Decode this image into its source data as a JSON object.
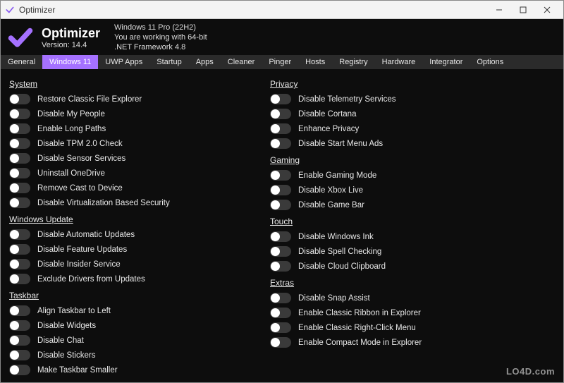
{
  "window": {
    "title": "Optimizer"
  },
  "header": {
    "app_name": "Optimizer",
    "version_label": "Version: 14.4",
    "os_line": "Windows 11 Pro (22H2)",
    "arch_line": "You are working with 64-bit",
    "net_line": ".NET Framework 4.8"
  },
  "tabs": {
    "items": [
      {
        "label": "General"
      },
      {
        "label": "Windows 11",
        "active": true
      },
      {
        "label": "UWP Apps"
      },
      {
        "label": "Startup"
      },
      {
        "label": "Apps"
      },
      {
        "label": "Cleaner"
      },
      {
        "label": "Pinger"
      },
      {
        "label": "Hosts"
      },
      {
        "label": "Registry"
      },
      {
        "label": "Hardware"
      },
      {
        "label": "Integrator"
      },
      {
        "label": "Options"
      }
    ]
  },
  "left": {
    "sections": [
      {
        "title": "System",
        "items": [
          {
            "label": "Restore Classic File Explorer"
          },
          {
            "label": "Disable My People"
          },
          {
            "label": "Enable Long Paths"
          },
          {
            "label": "Disable TPM 2.0 Check"
          },
          {
            "label": "Disable Sensor Services"
          },
          {
            "label": "Uninstall OneDrive"
          },
          {
            "label": "Remove Cast to Device"
          },
          {
            "label": "Disable Virtualization Based Security"
          }
        ]
      },
      {
        "title": "Windows Update",
        "items": [
          {
            "label": "Disable Automatic Updates"
          },
          {
            "label": "Disable Feature Updates"
          },
          {
            "label": "Disable Insider Service"
          },
          {
            "label": "Exclude Drivers from Updates"
          }
        ]
      },
      {
        "title": "Taskbar",
        "items": [
          {
            "label": "Align Taskbar to Left"
          },
          {
            "label": "Disable Widgets"
          },
          {
            "label": "Disable Chat"
          },
          {
            "label": "Disable Stickers"
          },
          {
            "label": "Make Taskbar Smaller"
          }
        ]
      }
    ]
  },
  "right": {
    "sections": [
      {
        "title": "Privacy",
        "items": [
          {
            "label": "Disable Telemetry Services"
          },
          {
            "label": "Disable Cortana"
          },
          {
            "label": "Enhance Privacy"
          },
          {
            "label": "Disable Start Menu Ads"
          }
        ]
      },
      {
        "title": "Gaming",
        "items": [
          {
            "label": "Enable Gaming Mode"
          },
          {
            "label": "Disable Xbox Live"
          },
          {
            "label": "Disable Game Bar"
          }
        ]
      },
      {
        "title": "Touch",
        "items": [
          {
            "label": "Disable Windows Ink"
          },
          {
            "label": "Disable Spell Checking"
          },
          {
            "label": "Disable Cloud Clipboard"
          }
        ]
      },
      {
        "title": "Extras",
        "items": [
          {
            "label": "Disable Snap Assist"
          },
          {
            "label": "Enable Classic Ribbon in Explorer"
          },
          {
            "label": "Enable Classic Right-Click Menu"
          },
          {
            "label": "Enable Compact Mode in Explorer"
          }
        ]
      }
    ]
  },
  "watermark": "LO4D.com",
  "colors": {
    "accent": "#a571ff",
    "bg": "#0d0d0d",
    "tabstrip": "#2b2b2b",
    "toggle_track": "#3a3a3a"
  }
}
